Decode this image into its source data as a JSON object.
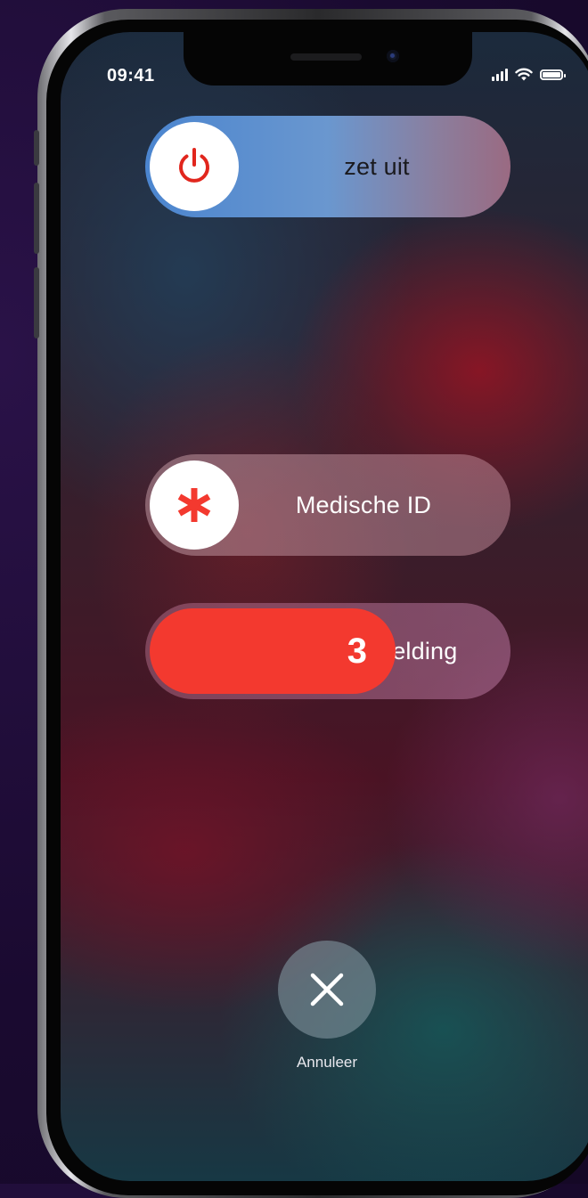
{
  "status_bar": {
    "time": "09:41",
    "signal_icon": "cellular-signal-icon",
    "wifi_icon": "wifi-icon",
    "battery_icon": "battery-icon"
  },
  "sliders": {
    "power_off": {
      "label": "zet uit",
      "icon": "power-icon",
      "icon_color": "#e1261d"
    },
    "medical_id": {
      "label": "Medische ID",
      "icon": "asterisk-icon",
      "icon_color": "#f3392f"
    },
    "emergency_sos": {
      "label": "nelding",
      "countdown": "3",
      "fill_color": "#f3392f"
    }
  },
  "cancel": {
    "icon": "close-icon",
    "label": "Annuleer"
  }
}
